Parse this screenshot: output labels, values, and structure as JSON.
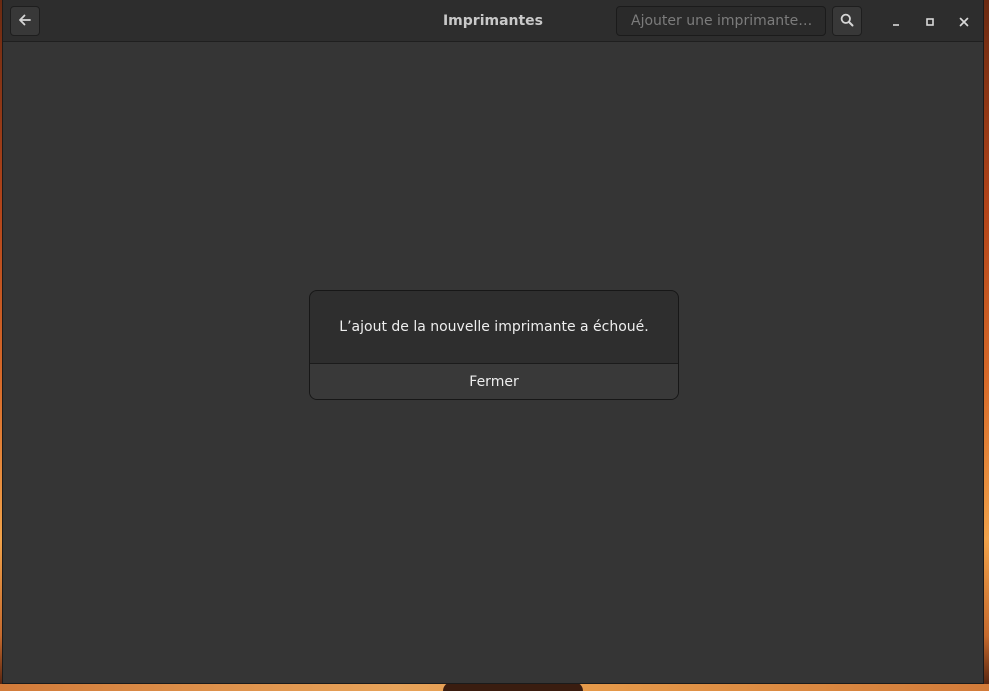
{
  "window": {
    "title": "Imprimantes"
  },
  "headerbar": {
    "back_icon": "arrow-left-icon",
    "search_placeholder": "Ajouter une imprimante…",
    "search_value": "",
    "search_icon": "search-icon",
    "window_controls": [
      "minimize-icon",
      "maximize-icon",
      "close-icon"
    ]
  },
  "dialog": {
    "message": "L’ajout de la nouvelle imprimante a échoué.",
    "close_button_label": "Fermer"
  },
  "colors": {
    "window_bg": "#353535",
    "headerbar_bg": "#2d2d2d",
    "dialog_bg": "#2e2e2e",
    "button_bg": "#393939",
    "text": "#eeeeee",
    "placeholder": "#7c7c7c"
  }
}
